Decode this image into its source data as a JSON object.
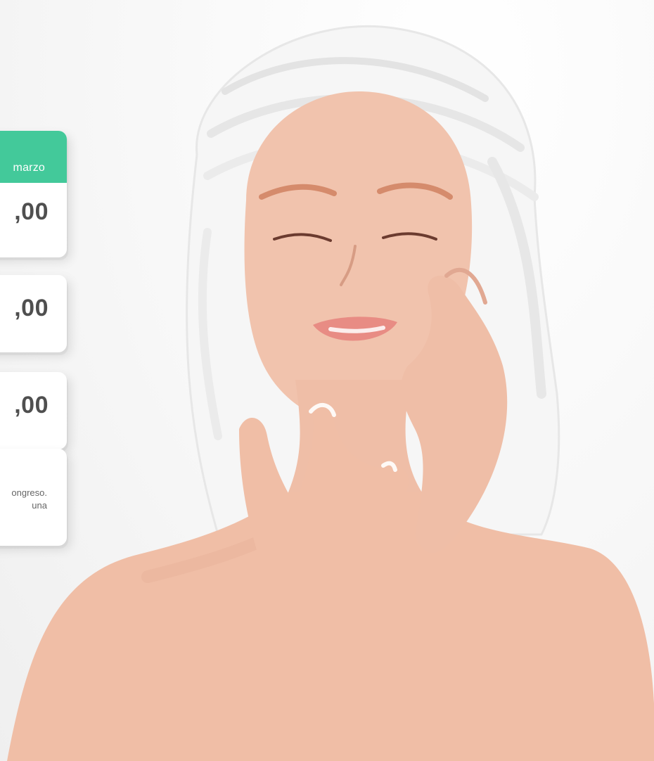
{
  "hero": {
    "image_alt": "woman with a white towel wrap, eyes closed, hands on face"
  },
  "cards": [
    {
      "header": "marzo",
      "price": ",00"
    },
    {
      "price": ",00"
    },
    {
      "price": ",00"
    },
    {
      "note_line1": "ongreso.",
      "note_line2": "una"
    }
  ],
  "colors": {
    "accent": "#43c99a",
    "text": "#4f4f4f",
    "background": "#f4f4f4"
  }
}
